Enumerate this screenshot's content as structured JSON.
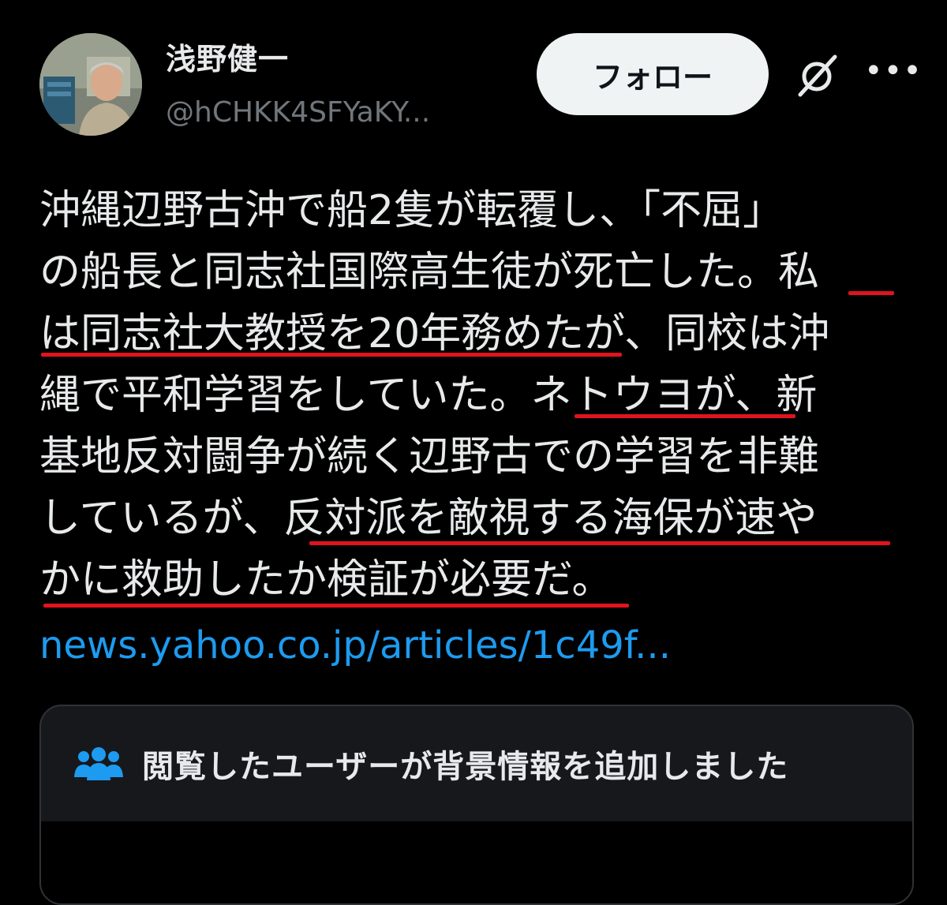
{
  "author": {
    "name": "浅野健一",
    "handle": "@hCHKK4SFYaKY..."
  },
  "actions": {
    "follow_label": "フォロー",
    "more_label": "•••"
  },
  "tweet": {
    "line1": "沖縄辺野古沖で船2隻が転覆し、「不屈」",
    "line2": "の船長と同志社国際高生徒が死亡した。私",
    "line3": "は同志社大教授を20年務めたが、同校は沖",
    "line4": "縄で平和学習をしていた。ネトウヨが、新",
    "line5": "基地反対闘争が続く辺野古での学習を非難",
    "line6": "しているが、反対派を敵視する海保が速や",
    "line7": "かに救助したか検証が必要だ。",
    "link": "news.yahoo.co.jp/articles/1c49f..."
  },
  "community_note": {
    "title": "閲覧したユーザーが背景情報を追加しました"
  },
  "colors": {
    "link": "#1d9bf0",
    "underline": "#e0141e",
    "note_icon": "#1d9bf0"
  }
}
